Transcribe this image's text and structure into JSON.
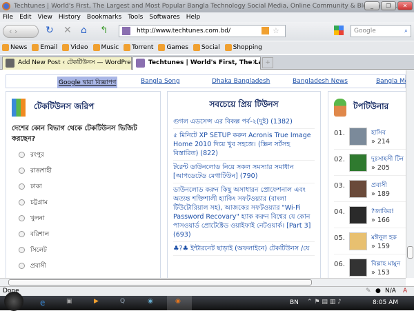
{
  "window": {
    "title": "Techtunes | World's First, The Largest and Most Popular Bangla Technology Social Media, Online Community & Blogging Pla..."
  },
  "menu": [
    "File",
    "Edit",
    "View",
    "History",
    "Bookmarks",
    "Tools",
    "Softwares",
    "Help"
  ],
  "navbar": {
    "url": "http://www.techtunes.com.bd/",
    "search_placeholder": "Google"
  },
  "bookmarks": [
    "News",
    "Email",
    "Video",
    "Music",
    "Torrent",
    "Games",
    "Social",
    "Shopping"
  ],
  "tabs": [
    {
      "label": "Add New Post ‹ টেকটিউনস — WordPress",
      "active": false
    },
    {
      "label": "Techtunes | World's First, The Lar...",
      "active": true
    }
  ],
  "ads": {
    "label": "Google দ্বারা বিজ্ঞাপণ",
    "links": [
      "Bangla Song",
      "Dhaka Bangladesh",
      "Bangladesh News",
      "Bangla Mo"
    ]
  },
  "poll": {
    "title": "টেকটিউনস জরিপ",
    "question": "দেশের কোন বিভাগ থেকে টেকটিউনস ভিজিট করছেন?",
    "options": [
      "রংপুর",
      "রাজশাহী",
      "ঢাকা",
      "চট্টগ্রাম",
      "খুলনা",
      "বরিশাল",
      "সিলেট",
      "প্রবাসী"
    ]
  },
  "popular": {
    "title": "সবচেয়ে প্রিয় টিউনস",
    "items": [
      "গুগল এডসেন্স এর বিকল্প পর্ব-২(দুই) (1382)",
      "৫ মিনিটে XP SETUP করুন Acronis True Image Home 2010 দিয়ে খুব সহজে। (স্ক্রিন সর্টসহ বিস্তারিত) (822)",
      "টরেন্ট ডাউনলোড নিয়ে সকল সমস্যার সমাধান [আপডেটেড মেগাটিউন] (790)",
      "ডাউনলোড করুন কিছু অসাধারন প্রোফেশনাল এবং অত্যন্ত শক্তিশালী হ্যাকিং সফটওয়্যার (বাংলা টিউটোরিয়াল সহ), আজকের সফটওয়্যার \"Wi-Fi Password Recovary\" হ্যাক করুন বিশ্বের যে কোন পাসওয়ার্ড প্রোটেক্টেড ওয়াইফাই নেটওয়ার্ক। [Part 3] (693)",
      "♣?♣ ইন্টারনেট ছাড়াই (অফলাইনে) টেকটিউনস /যে"
    ]
  },
  "toptuners": {
    "title": "টপটিউনার",
    "items": [
      {
        "rank": "01.",
        "name": "হাসিব",
        "count": "» 214",
        "color": "#7b8a9a"
      },
      {
        "rank": "02.",
        "name": "দুঃসাহসী টিন",
        "count": "» 205",
        "color": "#2f7a2f"
      },
      {
        "rank": "03.",
        "name": "প্রবাসী",
        "count": "» 189",
        "color": "#6a4a3a"
      },
      {
        "rank": "04.",
        "name": "?জাকির!",
        "count": "» 166",
        "color": "#2a2a2a"
      },
      {
        "rank": "05.",
        "name": "মঈনুল হক",
        "count": "» 159",
        "color": "#e8c070"
      },
      {
        "rank": "06.",
        "name": "বিল্লাহ মামুন",
        "count": "» 153",
        "color": "#333"
      }
    ]
  },
  "status": {
    "text": "Done",
    "na": "N/A"
  },
  "taskbar": {
    "lang": "BN",
    "time": "8:05 AM"
  }
}
